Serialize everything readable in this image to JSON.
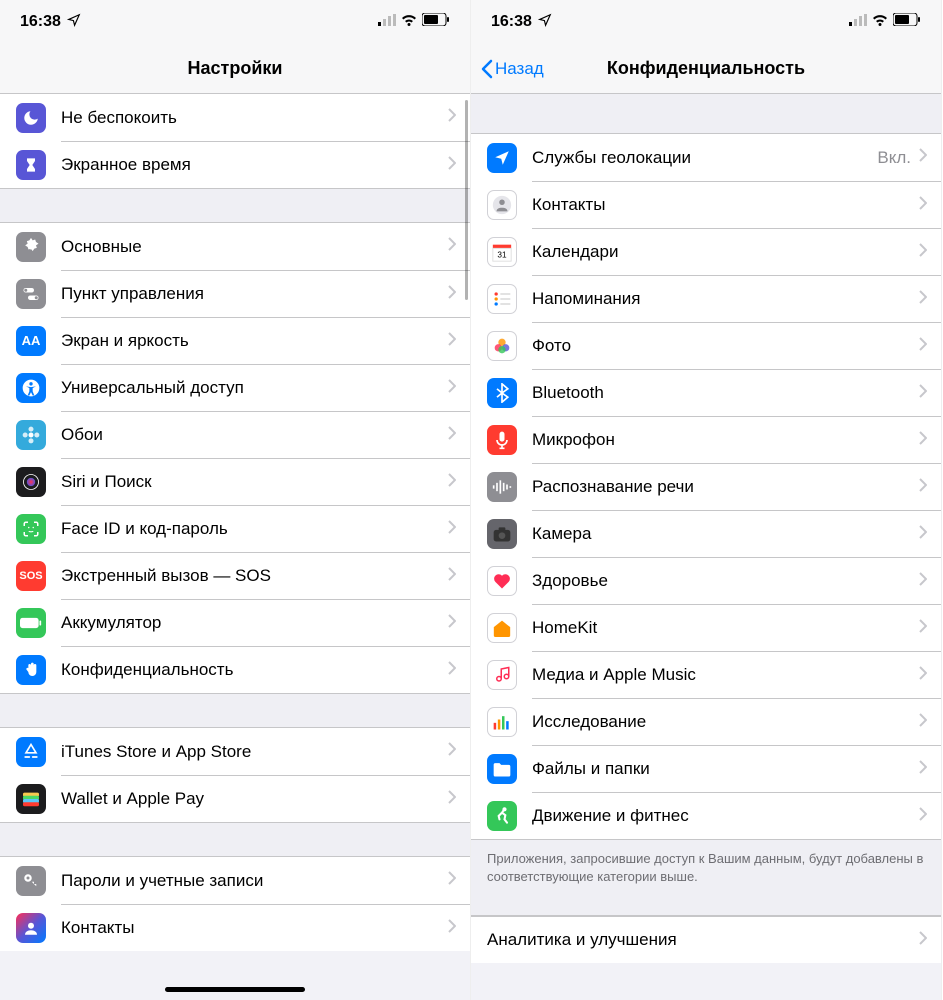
{
  "status": {
    "time": "16:38",
    "location_glyph": "➤"
  },
  "left": {
    "title": "Настройки",
    "group1": [
      {
        "label": "Не беспокоить",
        "icon": "moon",
        "bg": "bg-purple"
      },
      {
        "label": "Экранное время",
        "icon": "hourglass",
        "bg": "bg-purple"
      }
    ],
    "group2": [
      {
        "label": "Основные",
        "icon": "gear",
        "bg": "bg-gray"
      },
      {
        "label": "Пункт управления",
        "icon": "switches",
        "bg": "bg-gray"
      },
      {
        "label": "Экран и яркость",
        "icon": "AA",
        "bg": "bg-blue"
      },
      {
        "label": "Универсальный доступ",
        "icon": "accessibility",
        "bg": "bg-blue"
      },
      {
        "label": "Обои",
        "icon": "flower",
        "bg": "bg-lightblue"
      },
      {
        "label": "Siri и Поиск",
        "icon": "siri",
        "bg": "bg-black"
      },
      {
        "label": "Face ID и код-пароль",
        "icon": "faceid",
        "bg": "bg-green"
      },
      {
        "label": "Экстренный вызов — SOS",
        "icon": "SOS",
        "bg": "bg-red"
      },
      {
        "label": "Аккумулятор",
        "icon": "battery",
        "bg": "bg-green"
      },
      {
        "label": "Конфиденциальность",
        "icon": "hand",
        "bg": "bg-blue"
      }
    ],
    "group3": [
      {
        "label": "iTunes Store и App Store",
        "icon": "appstore",
        "bg": "bg-blue"
      },
      {
        "label": "Wallet и Apple Pay",
        "icon": "wallet",
        "bg": "bg-black"
      }
    ],
    "group4": [
      {
        "label": "Пароли и учетные записи",
        "icon": "key",
        "bg": "bg-gray"
      },
      {
        "label": "Контакты",
        "icon": "contacts",
        "bg": "bg-gradient"
      }
    ]
  },
  "right": {
    "back": "Назад",
    "title": "Конфиденциальность",
    "group1": [
      {
        "label": "Службы геолокации",
        "detail": "Вкл.",
        "icon": "location",
        "bg": "bg-blue"
      },
      {
        "label": "Контакты",
        "icon": "contacts2",
        "bg": "bg-white"
      },
      {
        "label": "Календари",
        "icon": "calendar",
        "bg": "bg-white"
      },
      {
        "label": "Напоминания",
        "icon": "reminders",
        "bg": "bg-white"
      },
      {
        "label": "Фото",
        "icon": "photos",
        "bg": "bg-white"
      },
      {
        "label": "Bluetooth",
        "icon": "bluetooth",
        "bg": "bg-blue"
      },
      {
        "label": "Микрофон",
        "icon": "mic",
        "bg": "bg-red"
      },
      {
        "label": "Распознавание речи",
        "icon": "waveform",
        "bg": "bg-gray"
      },
      {
        "label": "Камера",
        "icon": "camera",
        "bg": "bg-darkgray"
      },
      {
        "label": "Здоровье",
        "icon": "health",
        "bg": "bg-white"
      },
      {
        "label": "HomeKit",
        "icon": "home",
        "bg": "bg-white"
      },
      {
        "label": "Медиа и Apple Music",
        "icon": "music",
        "bg": "bg-white"
      },
      {
        "label": "Исследование",
        "icon": "research",
        "bg": "bg-white"
      },
      {
        "label": "Файлы и папки",
        "icon": "folder",
        "bg": "bg-blue"
      },
      {
        "label": "Движение и фитнес",
        "icon": "fitness",
        "bg": "bg-green"
      }
    ],
    "footer": "Приложения, запросившие доступ к Вашим данным, будут добавлены в соответствующие категории выше.",
    "group2": [
      {
        "label": "Аналитика и улучшения",
        "icon": "",
        "bg": ""
      }
    ]
  }
}
